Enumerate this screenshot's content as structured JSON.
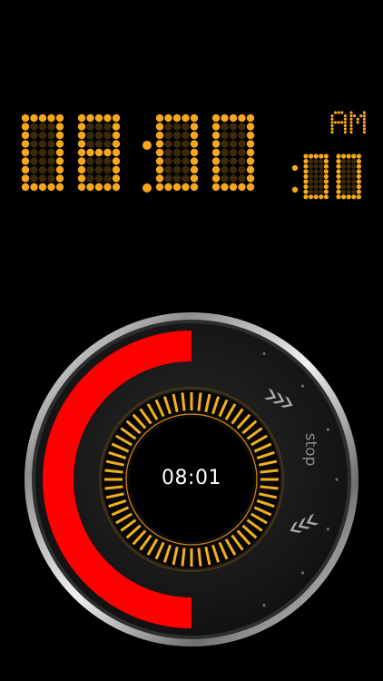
{
  "clock": {
    "digits": [
      "0",
      "8",
      "0",
      "0"
    ],
    "seconds": [
      "0",
      "0"
    ],
    "meridiem": "AM",
    "colors": {
      "lit": "#f6a71b",
      "dim": "#3b2a07"
    }
  },
  "timer": {
    "display": "08:01",
    "stop_label": "stop",
    "progress_fraction": 0.5,
    "colors": {
      "progress": "#ff0000",
      "ticks": "#f2b01c",
      "bezel": "#c8c8c8"
    }
  },
  "icons": {
    "up": "chevron-up-icon",
    "down": "chevron-down-icon"
  }
}
